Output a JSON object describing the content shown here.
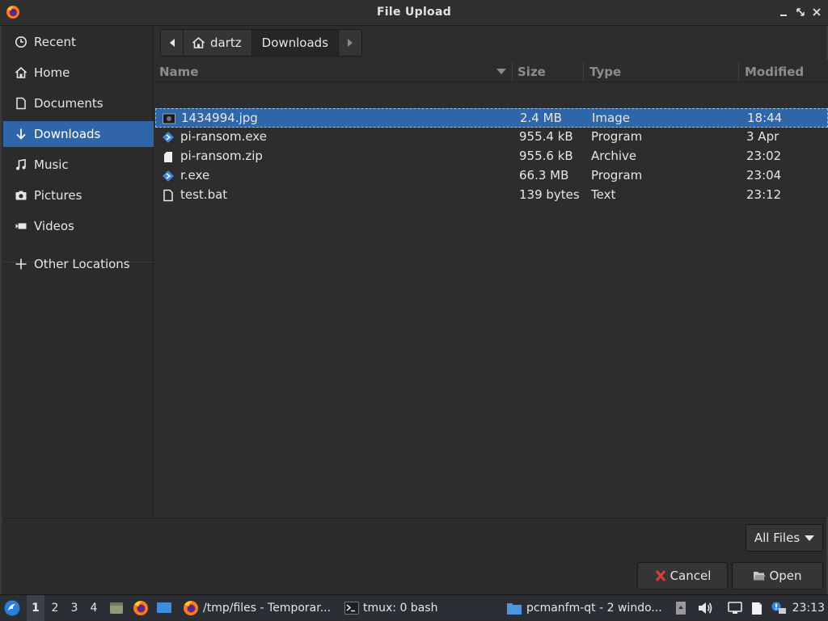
{
  "window": {
    "title": "File Upload"
  },
  "sidebar": {
    "items": [
      {
        "label": "Recent",
        "icon": "clock-icon"
      },
      {
        "label": "Home",
        "icon": "home-icon"
      },
      {
        "label": "Documents",
        "icon": "document-icon"
      },
      {
        "label": "Downloads",
        "icon": "download-arrow-icon",
        "active": true
      },
      {
        "label": "Music",
        "icon": "music-note-icon"
      },
      {
        "label": "Pictures",
        "icon": "camera-icon"
      },
      {
        "label": "Videos",
        "icon": "video-camera-icon"
      },
      {
        "label": "Other Locations",
        "icon": "plus-icon"
      }
    ]
  },
  "pathbar": {
    "segments": [
      "dartz",
      "Downloads"
    ]
  },
  "filelist": {
    "columns": [
      "Name",
      "Size",
      "Type",
      "Modified"
    ],
    "rows": [
      {
        "name": "1434994.jpg",
        "size": "2.4 MB",
        "type": "Image",
        "modified": "18:44",
        "icon": "image-file-icon",
        "selected": true
      },
      {
        "name": "pi-ransom.exe",
        "size": "955.4 kB",
        "type": "Program",
        "modified": "3 Apr",
        "icon": "executable-file-icon"
      },
      {
        "name": "pi-ransom.zip",
        "size": "955.6 kB",
        "type": "Archive",
        "modified": "23:02",
        "icon": "archive-file-icon"
      },
      {
        "name": "r.exe",
        "size": "66.3 MB",
        "type": "Program",
        "modified": "23:04",
        "icon": "executable-file-icon"
      },
      {
        "name": "test.bat",
        "size": "139 bytes",
        "type": "Text",
        "modified": "23:12",
        "icon": "text-file-icon"
      }
    ]
  },
  "footer": {
    "filter_label": "All Files",
    "cancel_label": "Cancel",
    "open_label": "Open"
  },
  "taskbar": {
    "workspaces": [
      "1",
      "2",
      "3",
      "4"
    ],
    "active_workspace": "1",
    "tasks": [
      {
        "label": "/tmp/files - Temporar...",
        "icon": "firefox-icon"
      },
      {
        "label": "tmux: 0 bash",
        "icon": "terminal-icon"
      },
      {
        "label": "pcmanfm-qt - 2 windo...",
        "icon": "folder-icon"
      }
    ],
    "clock": "23:13"
  },
  "colors": {
    "accent": "#2f66a8",
    "background": "#2d2d2d",
    "text": "#e6e6e6"
  }
}
